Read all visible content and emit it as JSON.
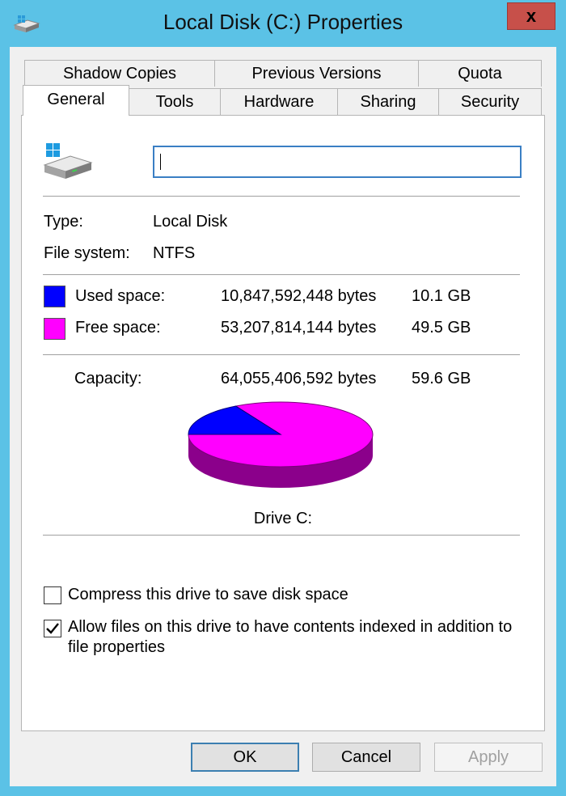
{
  "window": {
    "title": "Local Disk (C:) Properties",
    "close_label": "x"
  },
  "tabs": {
    "row1": [
      "Shadow Copies",
      "Previous Versions",
      "Quota"
    ],
    "row2": [
      "General",
      "Tools",
      "Hardware",
      "Sharing",
      "Security"
    ],
    "active": "General"
  },
  "general": {
    "name_value": "",
    "type_label": "Type:",
    "type_value": "Local Disk",
    "fs_label": "File system:",
    "fs_value": "NTFS",
    "used_label": "Used space:",
    "used_bytes": "10,847,592,448 bytes",
    "used_gb": "10.1 GB",
    "free_label": "Free space:",
    "free_bytes": "53,207,814,144 bytes",
    "free_gb": "49.5 GB",
    "capacity_label": "Capacity:",
    "capacity_bytes": "64,055,406,592 bytes",
    "capacity_gb": "59.6 GB",
    "drive_label": "Drive C:",
    "compress_label": "Compress this drive to save disk space",
    "compress_checked": false,
    "index_label_line1": "Allow files on this drive to have contents indexed in addition to",
    "index_label_line2": "file properties",
    "index_checked": true
  },
  "usage": {
    "used_bytes": 10847592448,
    "free_bytes": 53207814144
  },
  "colors": {
    "used": "#0000ff",
    "free": "#ff00ff",
    "free_shadow": "#8b008b",
    "used_shadow": "#00008b",
    "titlebar": "#5bc2e6",
    "close": "#c7504a"
  },
  "buttons": {
    "ok": "OK",
    "cancel": "Cancel",
    "apply": "Apply"
  }
}
